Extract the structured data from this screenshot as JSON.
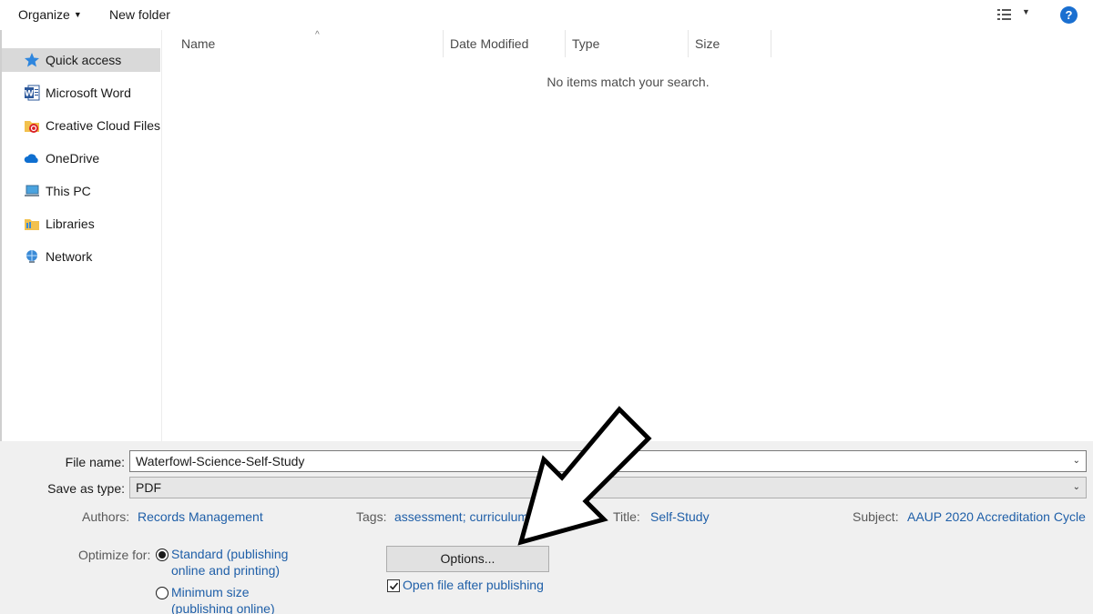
{
  "toolbar": {
    "organize_label": "Organize",
    "new_folder_label": "New folder",
    "help_label": "?"
  },
  "nav": {
    "items": [
      {
        "label": "Quick access",
        "icon": "star-icon"
      },
      {
        "label": "Microsoft Word",
        "icon": "word-icon"
      },
      {
        "label": "Creative Cloud Files",
        "icon": "creative-cloud-folder-icon"
      },
      {
        "label": "OneDrive",
        "icon": "onedrive-cloud-icon"
      },
      {
        "label": "This PC",
        "icon": "computer-icon"
      },
      {
        "label": "Libraries",
        "icon": "libraries-folder-icon"
      },
      {
        "label": "Network",
        "icon": "network-icon"
      }
    ]
  },
  "filelist": {
    "columns": [
      "Name",
      "Date Modified",
      "Type",
      "Size"
    ],
    "empty_message": "No items match your search."
  },
  "save": {
    "file_name_label": "File name:",
    "file_name_value": "Waterfowl-Science-Self-Study",
    "save_type_label": "Save as type:",
    "save_type_value": "PDF"
  },
  "meta": {
    "authors_label": "Authors:",
    "authors_value": "Records Management",
    "tags_label": "Tags:",
    "tags_value": "assessment; curriculum",
    "title_label": "Title:",
    "title_value": "Self-Study",
    "subject_label": "Subject:",
    "subject_value": "AAUP 2020 Accreditation Cycle"
  },
  "optimize": {
    "label": "Optimize for:",
    "standard_line1": "Standard (publishing",
    "standard_line2": "online and printing)",
    "minimum_line1": "Minimum size",
    "minimum_line2": "(publishing online)",
    "selected": "standard"
  },
  "options_button_label": "Options...",
  "open_after_label": "Open file after publishing",
  "open_after_checked": true,
  "colors": {
    "link_blue": "#1f5fa8",
    "help_blue": "#1a6fd0",
    "panel_gray": "#f0f0f0",
    "selected_gray": "#d9d9d9"
  }
}
